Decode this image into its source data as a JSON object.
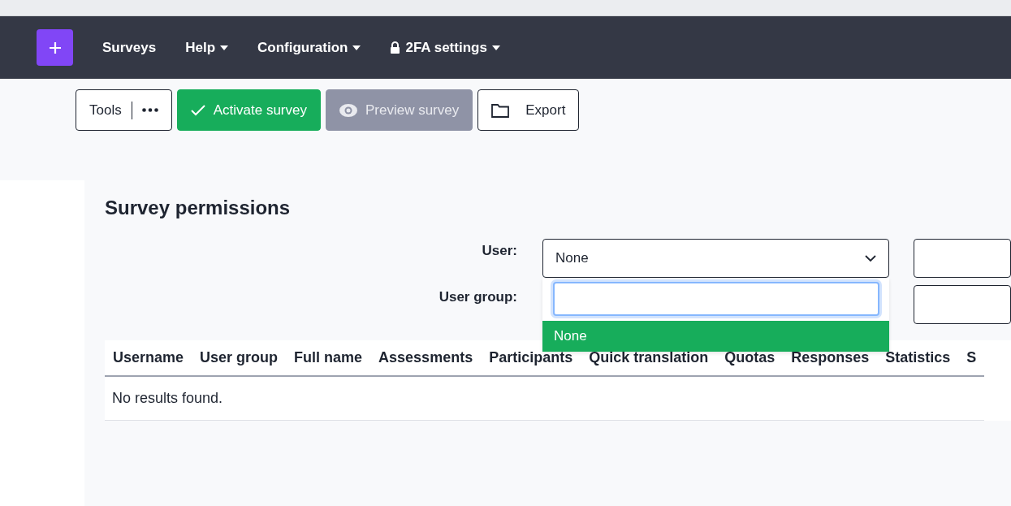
{
  "navbar": {
    "items": [
      {
        "label": "Surveys",
        "dropdown": false,
        "locked": false
      },
      {
        "label": "Help",
        "dropdown": true,
        "locked": false
      },
      {
        "label": "Configuration",
        "dropdown": true,
        "locked": false
      },
      {
        "label": "2FA settings",
        "dropdown": true,
        "locked": true
      }
    ]
  },
  "toolbar": {
    "buttons": [
      {
        "label": "Tools",
        "kind": "tools",
        "disabled": false
      },
      {
        "label": "Activate survey",
        "kind": "activate",
        "disabled": false
      },
      {
        "label": "Preview survey",
        "kind": "preview",
        "disabled": true
      },
      {
        "label": "Export",
        "kind": "export",
        "disabled": false
      }
    ]
  },
  "title": "Survey permissions",
  "form": {
    "user_label": "User:",
    "user_value": "None",
    "user_group_label": "User group:",
    "options": [
      {
        "label": "None",
        "selected": true
      }
    ]
  },
  "table": {
    "columns": [
      "Username",
      "User group",
      "Full name",
      "Assessments",
      "Participants",
      "Quick translation",
      "Quotas",
      "Responses",
      "Statistics",
      "S"
    ],
    "empty_message": "No results found."
  }
}
